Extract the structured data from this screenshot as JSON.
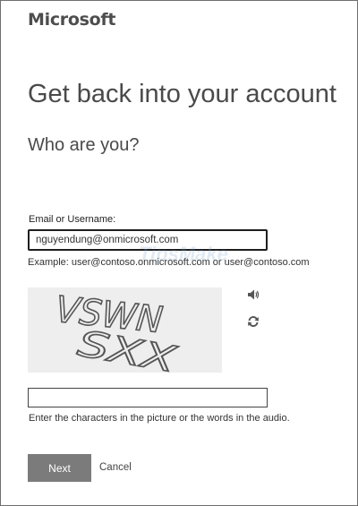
{
  "brand": {
    "logo_text": "Microsoft"
  },
  "heading": {
    "title": "Get back into your account",
    "subtitle": "Who are you?"
  },
  "email": {
    "label": "Email or Username:",
    "value": "nguyendung@onmicrosoft.com",
    "example": "Example: user@contoso.onmicrosoft.com or user@contoso.com"
  },
  "watermark": {
    "text": "TipsMake"
  },
  "captcha": {
    "image_text_line1": "VSWN",
    "image_text_line2": "SXX",
    "input_value": "",
    "hint": "Enter the characters in the picture or the words in the audio.",
    "audio_icon": "speaker-icon",
    "refresh_icon": "refresh-icon"
  },
  "actions": {
    "next_label": "Next",
    "cancel_label": "Cancel"
  },
  "colors": {
    "next_button": "#7b7b7b",
    "text": "#333333",
    "frame_border": "#6f6f6f"
  }
}
